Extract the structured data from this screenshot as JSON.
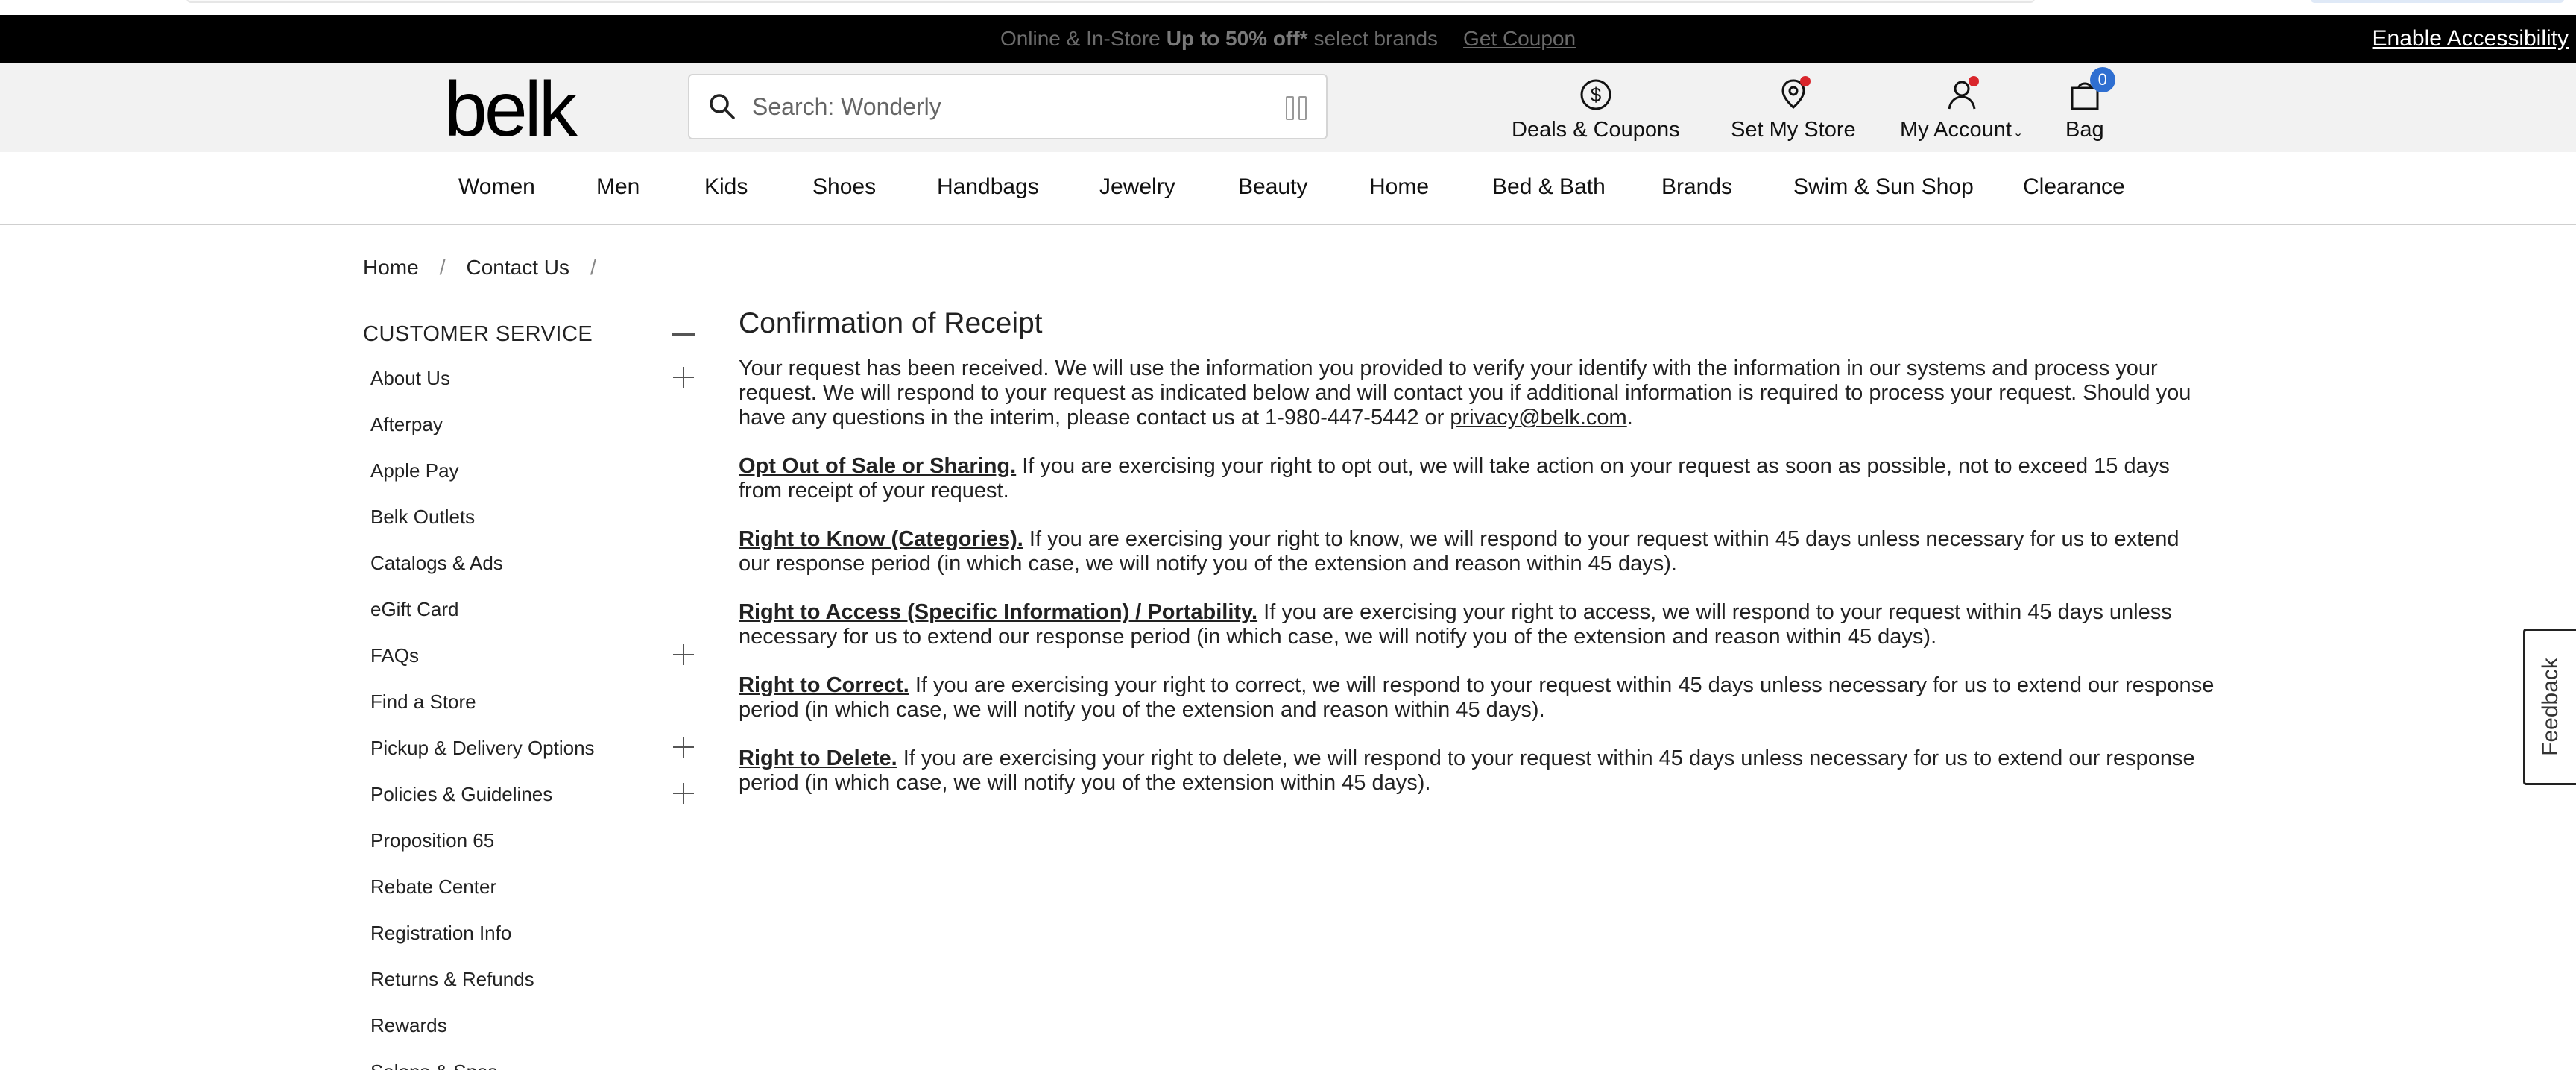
{
  "promo": {
    "prefix": "Online & In-Store",
    "highlight": "Up to 50% off*",
    "suffix": "select brands",
    "coupon_label": "Get Coupon",
    "accessibility_label": "Enable Accessibility"
  },
  "header": {
    "logo_text": "belk",
    "search_placeholder": "Search: Wonderly",
    "deals_label": "Deals & Coupons",
    "store_label": "Set My Store",
    "account_label": "My Account",
    "bag_label": "Bag",
    "bag_count": "0"
  },
  "nav": {
    "items": [
      "Women",
      "Men",
      "Kids",
      "Shoes",
      "Handbags",
      "Jewelry",
      "Beauty",
      "Home",
      "Bed & Bath",
      "Brands",
      "Swim & Sun Shop",
      "Clearance"
    ]
  },
  "breadcrumb": {
    "items": [
      "Home",
      "Contact Us"
    ],
    "separator": "/"
  },
  "sidebar": {
    "title": "CUSTOMER SERVICE",
    "items": [
      {
        "label": "About Us"
      },
      {
        "label": "Afterpay"
      },
      {
        "label": "Apple Pay"
      },
      {
        "label": "Belk Outlets"
      },
      {
        "label": "Catalogs & Ads"
      },
      {
        "label": "eGift Card"
      },
      {
        "label": "FAQs"
      },
      {
        "label": "Find a Store"
      },
      {
        "label": "Pickup & Delivery Options"
      },
      {
        "label": "Policies & Guidelines"
      },
      {
        "label": "Proposition 65"
      },
      {
        "label": "Rebate Center"
      },
      {
        "label": "Registration Info"
      },
      {
        "label": "Returns & Refunds"
      },
      {
        "label": "Rewards"
      },
      {
        "label": "Salons & Spas"
      }
    ]
  },
  "main": {
    "title": "Confirmation of Receipt",
    "intro_before_link": "Your request has been received. We will use the information you provided to verify your identify with the information in our systems and process your request. We will respond to your request as indicated below and will contact you if additional information is required to process your request. Should you have any questions in the interim, please contact us at 1-980-447-5442 or ",
    "intro_link": "privacy@belk.com",
    "intro_after_link": ".",
    "sections": [
      {
        "heading": "Opt Out of Sale or Sharing.",
        "text": " If you are exercising your right to opt out, we will take action on your request as soon as possible, not to exceed 15 days from receipt of your request."
      },
      {
        "heading": "Right to Know (Categories).",
        "text": " If you are exercising your right to know, we will respond to your request within 45 days unless necessary for us to extend our response period (in which case, we will notify you of the extension and reason within 45 days)."
      },
      {
        "heading": "Right to Access (Specific Information) / Portability.",
        "text": " If you are exercising your right to access, we will respond to your request within 45 days unless necessary for us to extend our response period (in which case, we will notify you of the extension and reason within 45 days)."
      },
      {
        "heading": "Right to Correct.",
        "text": " If you are exercising your right to correct, we will respond to your request within 45 days unless necessary for us to extend our response period (in which case, we will notify you of the extension and reason within 45 days)."
      },
      {
        "heading": "Right to Delete.",
        "text": " If you are exercising your right to delete, we will respond to your request within 45 days unless necessary for us to extend our response period (in which case, we will notify you of the extension within 45 days)."
      }
    ]
  },
  "feedback": {
    "label": "Feedback"
  },
  "colors": {
    "promo_bg": "#000000",
    "header_bg": "#f2f2f2",
    "badge": "#2f6fd1",
    "notify_dot": "#d9262c"
  }
}
